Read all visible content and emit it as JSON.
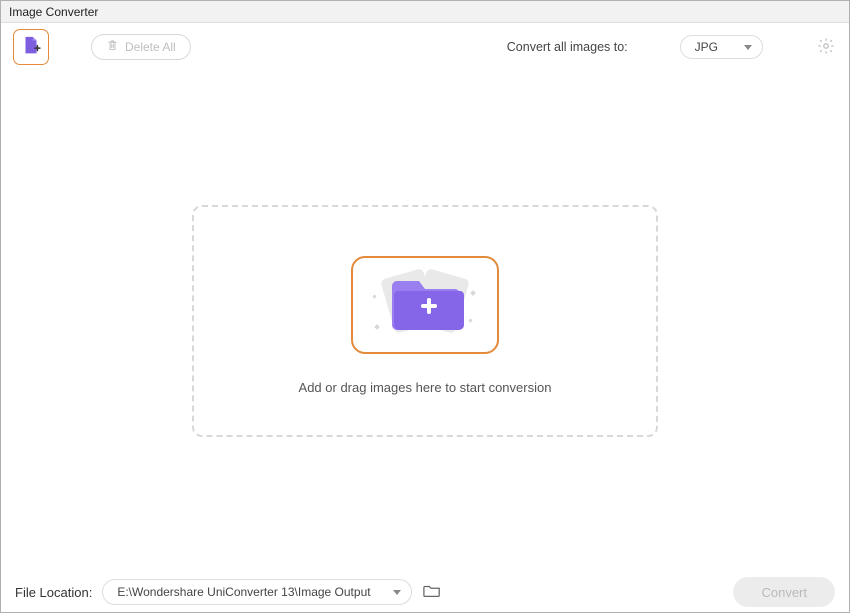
{
  "window": {
    "title": "Image Converter"
  },
  "toolbar": {
    "delete_all_label": "Delete All",
    "convert_to_label": "Convert all images to:",
    "format_selected": "JPG"
  },
  "dropzone": {
    "hint": "Add or drag images here to start conversion"
  },
  "footer": {
    "file_location_label": "File Location:",
    "file_location_path": "E:\\Wondershare UniConverter 13\\Image Output",
    "convert_label": "Convert"
  }
}
